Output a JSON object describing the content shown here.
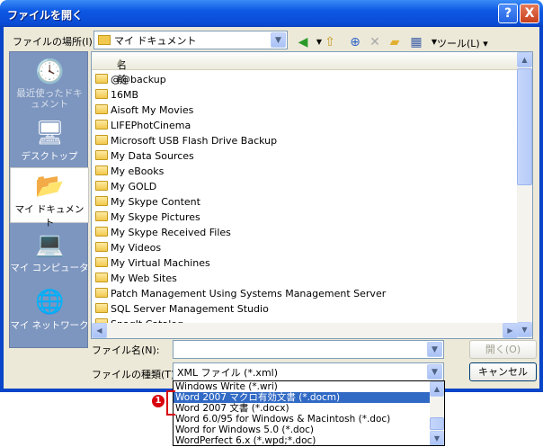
{
  "window": {
    "title": "ファイルを開く",
    "help_label": "?",
    "close_label": "X"
  },
  "location": {
    "label": "ファイルの場所(I):",
    "value": "マイ ドキュメント",
    "tools_label": "ツール(L)"
  },
  "places": [
    {
      "label": "最近使ったドキュメント",
      "icon": "recent-documents-icon",
      "selected": false
    },
    {
      "label": "デスクトップ",
      "icon": "desktop-icon",
      "selected": false
    },
    {
      "label": "マイ ドキュメント",
      "icon": "my-documents-icon",
      "selected": true
    },
    {
      "label": "マイ コンピュータ",
      "icon": "my-computer-icon",
      "selected": false
    },
    {
      "label": "マイ ネットワーク",
      "icon": "my-network-icon",
      "selected": false
    }
  ],
  "file_list": {
    "column_header": "名前",
    "items": [
      "@@backup",
      "16MB",
      "Aisoft My Movies",
      "LIFEPhotCinema",
      "Microsoft USB Flash Drive Backup",
      "My Data Sources",
      "My eBooks",
      "My GOLD",
      "My Skype Content",
      "My Skype Pictures",
      "My Skype Received Files",
      "My Videos",
      "My Virtual Machines",
      "My Web Sites",
      "Patch Management Using Systems Management Server",
      "SQL Server Management Studio",
      "SnagIt Catalog"
    ]
  },
  "filename": {
    "label": "ファイル名(N):",
    "value": ""
  },
  "filetype": {
    "label": "ファイルの種類(T):",
    "value": "XML ファイル (*.xml)"
  },
  "buttons": {
    "open_label": "開く(O)",
    "cancel_label": "キャンセル"
  },
  "filetype_options": [
    "Windows Write (*.wri)",
    "Word 2007 マクロ有効文書 (*.docm)",
    "Word 2007 文書 (*.docx)",
    "Word 6.0/95 for Windows & Macintosh (*.doc)",
    "Word for Windows 5.0 (*.doc)",
    "WordPerfect 6.x (*.wpd;*.doc)"
  ],
  "annotation": {
    "marker_label": "1",
    "accent": "#d9000d"
  },
  "colors": {
    "title_bar": "#0a4bd4",
    "selection": "#316ac5",
    "dialog_bg": "#ece9d8"
  }
}
